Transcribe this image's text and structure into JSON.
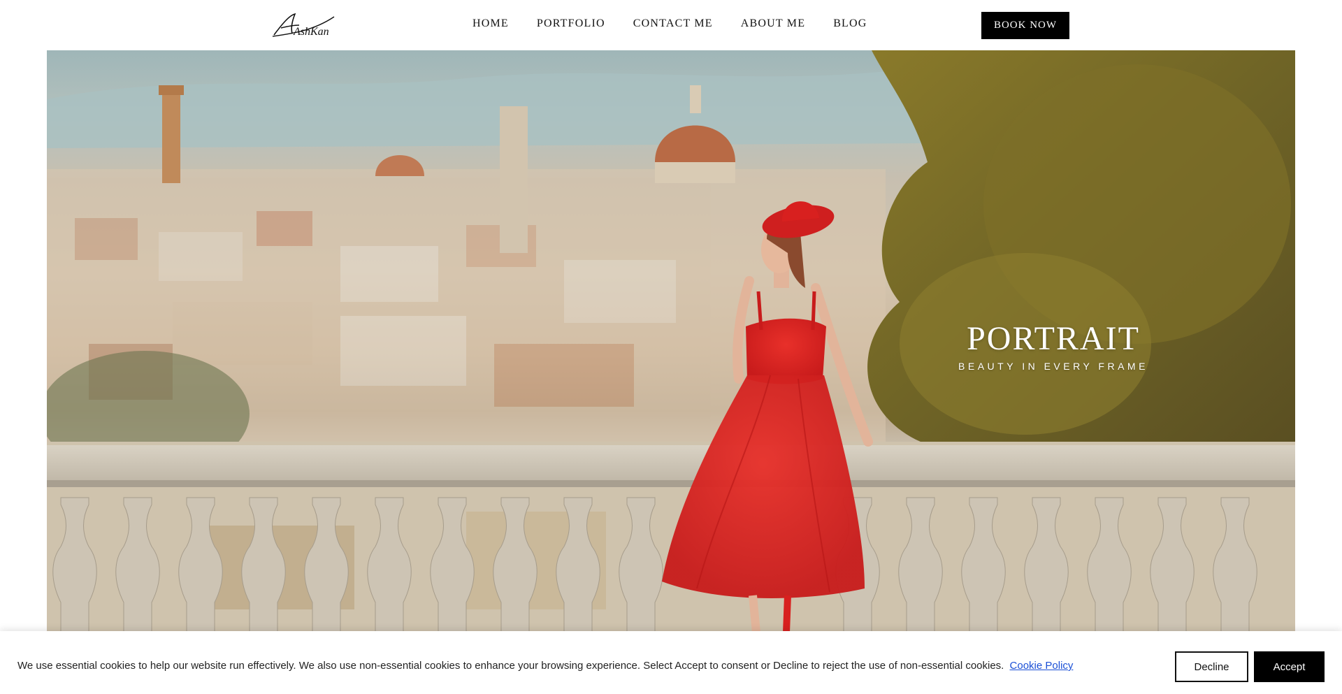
{
  "header": {
    "logo_text": "AshKan",
    "nav": [
      {
        "label": "HOME"
      },
      {
        "label": "PORTFOLIO"
      },
      {
        "label": "CONTACT ME"
      },
      {
        "label": "ABOUT ME"
      },
      {
        "label": "BLOG"
      }
    ],
    "book_label": "BOOK NOW"
  },
  "hero": {
    "title": "PORTRAIT",
    "subtitle": "BEAUTY IN EVERY FRAME",
    "image": "portrait-woman-red-dress-florence-balustrade"
  },
  "cookie_banner": {
    "message": "We use essential cookies to help our website run effectively. We also use non-essential cookies to enhance your browsing experience. Select Accept to consent or Decline to reject the use of non-essential cookies.",
    "policy_link": "Cookie Policy",
    "decline_label": "Decline",
    "accept_label": "Accept"
  },
  "colors": {
    "accent": "#000000",
    "dress": "#d8201f",
    "link": "#1a4fd6"
  }
}
